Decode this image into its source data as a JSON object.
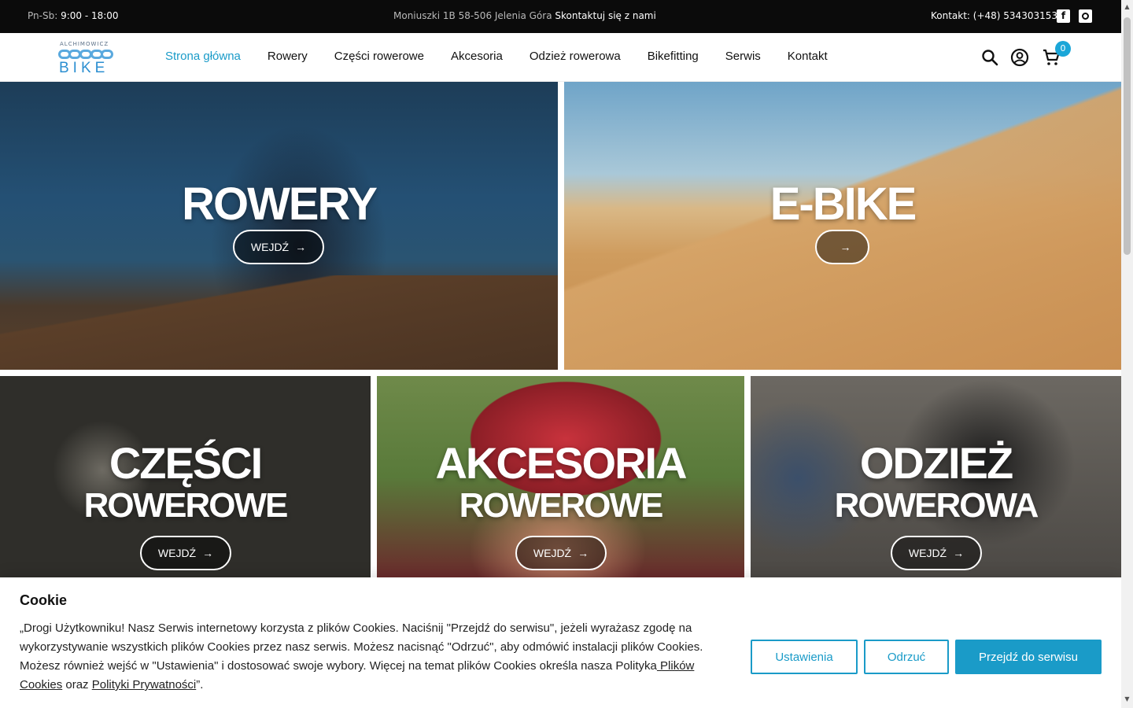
{
  "topbar": {
    "hours_label": "Pn-Sb:",
    "hours_value": "9:00 - 18:00",
    "address": "Moniuszki 1B 58-506 Jelenia Góra",
    "contact_link": "Skontaktuj się z nami",
    "contact_phone": "Kontakt: (+48) 534303153",
    "facebook_icon": "facebook-icon",
    "instagram_icon": "instagram-icon"
  },
  "header": {
    "logo_small": "ALCHIMOWICZ",
    "logo_big": "BIKE",
    "nav": [
      "Strona główna",
      "Rowery",
      "Części rowerowe",
      "Akcesoria",
      "Odzież rowerowa",
      "Bikefitting",
      "Serwis",
      "Kontakt"
    ],
    "cart_count": "0",
    "accent_color": "#1a9bc8"
  },
  "tiles": {
    "rowery": {
      "title": "ROWERY",
      "button": "WEJDŹ"
    },
    "ebike": {
      "title": "E-BIKE",
      "button": ""
    },
    "czesci": {
      "title_line1": "CZĘŚCI",
      "title_line2": "ROWEROWE",
      "button": "WEJDŹ"
    },
    "akcesoria": {
      "title_line1": "AKCESORIA",
      "title_line2": "ROWEROWE",
      "button": "WEJDŹ"
    },
    "odziez": {
      "title_line1": "ODZIEŻ",
      "title_line2": "ROWEROWA",
      "button": "WEJDŹ"
    }
  },
  "cookie": {
    "title": "Cookie",
    "text": "„Drogi Użytkowniku! Nasz Serwis internetowy korzysta z plików Cookies. Naciśnij  \"Przejdź do serwisu\", jeżeli wyrażasz zgodę na wykorzystywanie wszystkich plików Cookies przez nasz serwis. Możesz nacisnąć \"Odrzuć\", aby odmówić instalacji plików Cookies. Możesz również wejść w \"Ustawienia\" i dostosować swoje wybory. Więcej na temat plików Cookies określa nasza Polityka",
    "link_cookies": " Plików Cookies",
    "and": " oraz ",
    "link_privacy": "Polityki Prywatności",
    "end": "”.",
    "btn_settings": "Ustawienia",
    "btn_reject": "Odrzuć",
    "btn_accept": "Przejdź do serwisu"
  }
}
